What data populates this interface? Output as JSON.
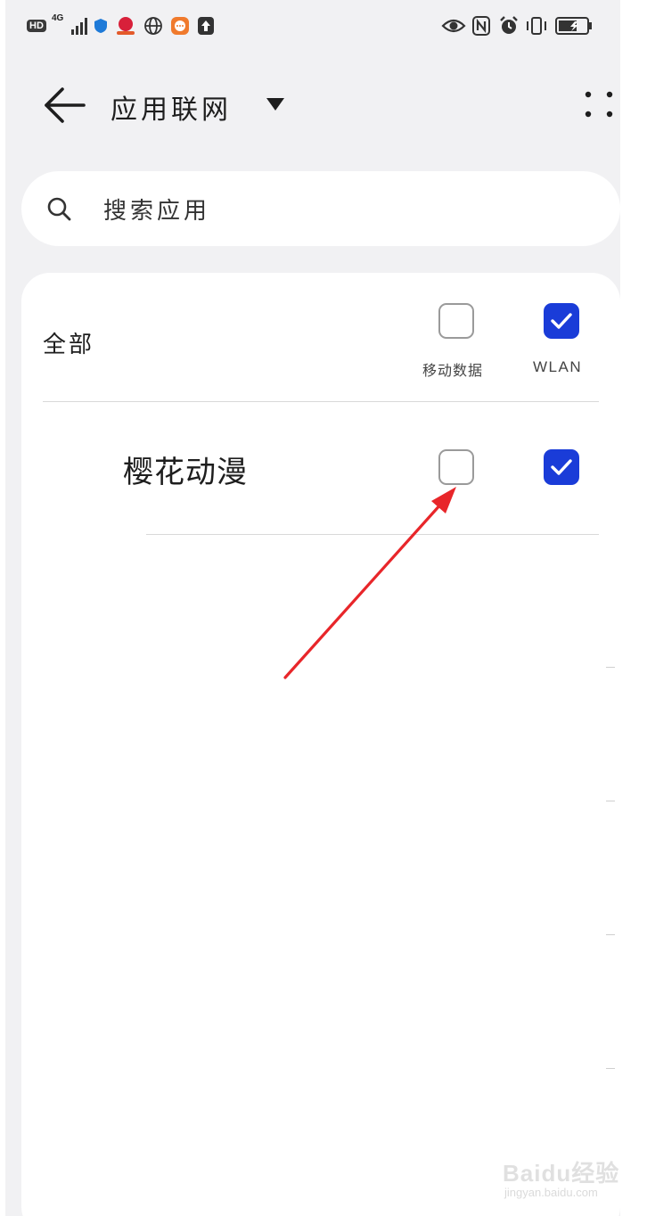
{
  "status_bar": {
    "hd": "HD",
    "network": "4G",
    "icons": [
      "hd-icon",
      "signal-icon",
      "shield-icon",
      "app-badge-icon",
      "globe-icon",
      "message-icon",
      "upload-icon",
      "eye-icon",
      "nfc-icon",
      "alarm-icon",
      "vibrate-icon",
      "battery-icon"
    ]
  },
  "header": {
    "title": "应用联网",
    "back_icon": "back-arrow-icon",
    "dropdown_icon": "triangle-down-icon",
    "more_icon": "more-vertical-icon"
  },
  "search": {
    "placeholder": "搜索应用",
    "icon": "search-icon"
  },
  "list": {
    "all_label": "全部",
    "columns": {
      "mobile_data": "移动数据",
      "wlan": "WLAN"
    },
    "all_state": {
      "mobile_data": false,
      "wlan": true
    },
    "apps": [
      {
        "name": "樱花动漫",
        "mobile_data": false,
        "wlan": true
      }
    ]
  },
  "annotation": {
    "color": "#e8262a"
  },
  "colors": {
    "accent": "#1a3cd8",
    "background": "#f1f1f3",
    "card": "#ffffff"
  },
  "watermark": {
    "brand": "Baidu经验",
    "url": "jingyan.baidu.com"
  }
}
